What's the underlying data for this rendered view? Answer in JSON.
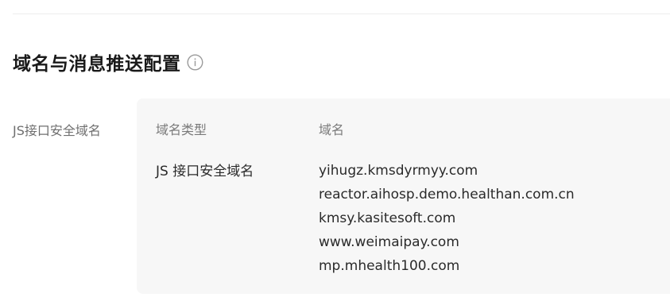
{
  "section": {
    "title": "域名与消息推送配置"
  },
  "row": {
    "label": "JS接口安全域名"
  },
  "table": {
    "columns": [
      "域名类型",
      "域名"
    ],
    "type_value": "JS 接口安全域名",
    "domains": [
      "yihugz.kmsdyrmyy.com",
      "reactor.aihosp.demo.healthan.com.cn",
      "kmsy.kasitesoft.com",
      "www.weimaipay.com",
      "mp.mhealth100.com"
    ]
  },
  "icons": {
    "info": "info-circle-icon"
  },
  "colors": {
    "panel_bg": "#f7f7f7",
    "label_gray": "#6f6f6f",
    "text_dark": "#2a2a2a"
  }
}
